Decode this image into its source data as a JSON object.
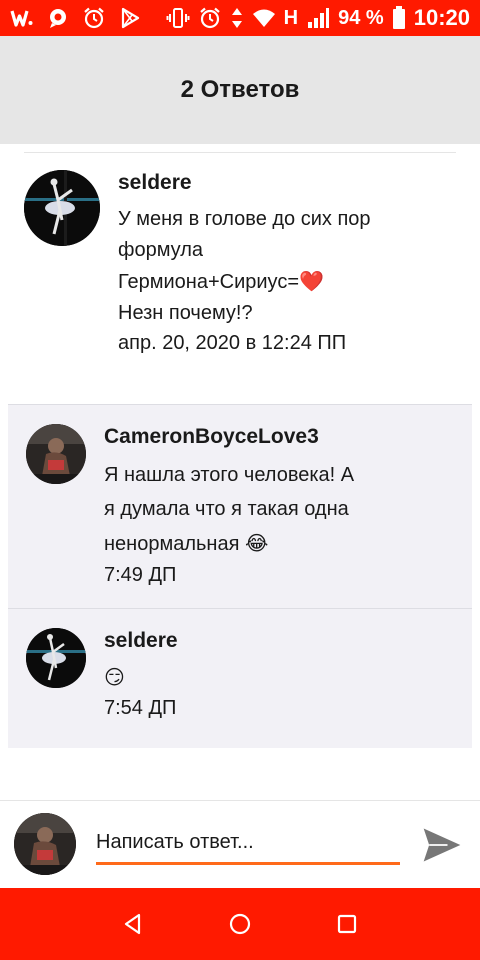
{
  "status_bar": {
    "network": "H",
    "battery": "94 %",
    "time": "10:20",
    "left_icons": [
      "app-w-icon",
      "app-chat-icon",
      "alarm-icon",
      "play-store-icon"
    ],
    "right_icons": [
      "vibrate-icon",
      "alarm-icon",
      "data-arrows-icon",
      "wifi-icon",
      "signal-icon",
      "battery-icon"
    ]
  },
  "header": {
    "title": "2 Ответов"
  },
  "main_comment": {
    "author": "seldere",
    "text_lines": [
      "У меня в голове до сих пор",
      "формула",
      "Гермиона+Сириус="
    ],
    "heart": "❤️",
    "text_line4": "Незн почему!?",
    "time": "апр. 20, 2020 в 12:24 ПП"
  },
  "replies": [
    {
      "author": "CameronBoyceLove3",
      "text_lines": [
        "Я нашла этого человека! А",
        "я думала что я такая одна",
        "ненормальная "
      ],
      "emoji": "😂",
      "time": "7:49 ДП"
    },
    {
      "author": "seldere",
      "emoji": "😏",
      "time": "7:54 ДП"
    }
  ],
  "compose": {
    "placeholder": "Написать ответ..."
  },
  "colors": {
    "status_bar": "#ff1a00",
    "header_bg": "#e6e6e6",
    "reply_bg": "#f2f1f6",
    "input_underline": "#ff6a1a",
    "send_icon": "#777777"
  }
}
